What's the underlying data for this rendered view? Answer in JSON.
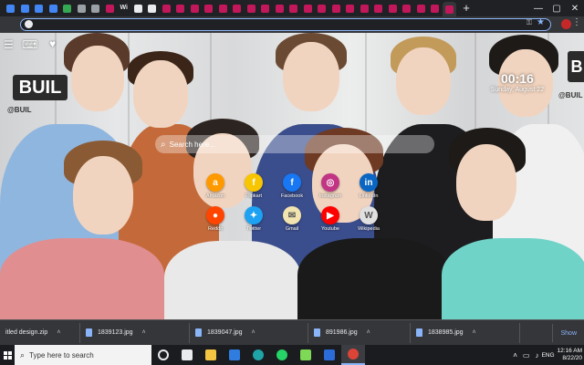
{
  "browser": {
    "tabs": [
      {
        "color": "#4285f4"
      },
      {
        "color": "#4285f4"
      },
      {
        "color": "#4285f4"
      },
      {
        "color": "#4285f4"
      },
      {
        "color": "#34a853"
      },
      {
        "color": "#9aa0a6"
      },
      {
        "color": "#9aa0a6"
      },
      {
        "color": "#c2185b"
      },
      {
        "color": "#e8eaed",
        "text": "Wi"
      },
      {
        "color": "#e8eaed"
      },
      {
        "color": "#e8eaed"
      },
      {
        "color": "#c2185b"
      },
      {
        "color": "#c2185b"
      },
      {
        "color": "#c2185b"
      },
      {
        "color": "#c2185b"
      },
      {
        "color": "#c2185b"
      },
      {
        "color": "#c2185b"
      },
      {
        "color": "#c2185b"
      },
      {
        "color": "#c2185b"
      },
      {
        "color": "#c2185b"
      },
      {
        "color": "#c2185b"
      },
      {
        "color": "#c2185b"
      },
      {
        "color": "#c2185b"
      },
      {
        "color": "#c2185b"
      },
      {
        "color": "#c2185b"
      },
      {
        "color": "#c2185b"
      },
      {
        "color": "#c2185b"
      },
      {
        "color": "#c2185b"
      },
      {
        "color": "#c2185b"
      },
      {
        "color": "#c2185b"
      },
      {
        "color": "#c2185b"
      },
      {
        "color": "#c2185b",
        "active": true
      }
    ],
    "new_tab_label": "+",
    "window_controls": {
      "minimize": "—",
      "maximize": "▢",
      "close": "✕"
    },
    "omnibox_value": "",
    "accent": "#8ab4f8"
  },
  "newtab": {
    "clock_time": "00:16",
    "clock_date": "Sunday, August 22",
    "search_placeholder": "Search here...",
    "top_icons": [
      "gamepad-icon",
      "heart-icon"
    ],
    "brand_sign": "BUIL",
    "brand_sign_right": "B",
    "brand_tag": "@BUIL",
    "brand_tag_right": "@BUIL",
    "shortcuts_row1": [
      {
        "label": "Amazon",
        "color": "#ff9900",
        "glyph": "a",
        "icon": "amazon-icon"
      },
      {
        "label": "Flipkart",
        "color": "#f7c600",
        "glyph": "f",
        "icon": "flipkart-icon"
      },
      {
        "label": "Facebook",
        "color": "#1877f2",
        "glyph": "f",
        "icon": "facebook-icon"
      },
      {
        "label": "Instagram",
        "color": "#c13584",
        "glyph": "◎",
        "icon": "instagram-icon"
      },
      {
        "label": "LinkedIn",
        "color": "#0a66c2",
        "glyph": "in",
        "icon": "linkedin-icon"
      }
    ],
    "shortcuts_row2": [
      {
        "label": "Reddit",
        "color": "#ff4500",
        "glyph": "●",
        "icon": "reddit-icon"
      },
      {
        "label": "Twitter",
        "color": "#1da1f2",
        "glyph": "✦",
        "icon": "twitter-icon"
      },
      {
        "label": "Gmail",
        "color": "#f1e4b0",
        "glyph": "✉",
        "icon": "gmail-icon"
      },
      {
        "label": "Youtube",
        "color": "#ff0000",
        "glyph": "▶",
        "icon": "youtube-icon"
      },
      {
        "label": "Wikipedia",
        "color": "#e0e0e0",
        "glyph": "W",
        "icon": "wikipedia-icon"
      }
    ]
  },
  "downloads": {
    "items": [
      "itled design.zip",
      "1839123.jpg",
      "1839047.jpg",
      "891986.jpg",
      "1838985.jpg"
    ],
    "show_all": "Show"
  },
  "taskbar": {
    "search_placeholder": "Type here to search",
    "apps": [
      {
        "name": "cortana",
        "color": "#e8eaed"
      },
      {
        "name": "task-view",
        "color": "#e8eaed"
      },
      {
        "name": "file-explorer",
        "color": "#f4c542"
      },
      {
        "name": "mail",
        "color": "#2f7de1"
      },
      {
        "name": "edge",
        "color": "#1fa4a8"
      },
      {
        "name": "whatsapp",
        "color": "#25d366"
      },
      {
        "name": "notepad",
        "color": "#7ed957"
      },
      {
        "name": "photos",
        "color": "#2b6cd9"
      },
      {
        "name": "chrome",
        "color": "#db4437",
        "active": true
      }
    ],
    "language": "ENG",
    "time": "12:16 AM",
    "date": "8/22/20"
  }
}
